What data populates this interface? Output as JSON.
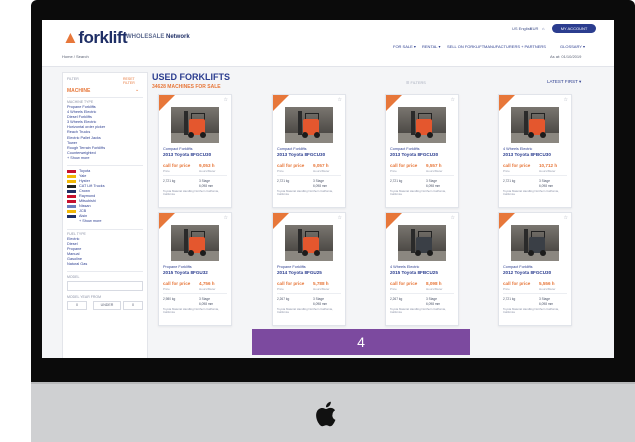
{
  "header": {
    "logo_main": "forklift",
    "logo_network_prefix": "WHOLESALE",
    "logo_network": "Network",
    "utility": [
      "US English",
      "EUR",
      "⌂"
    ],
    "account_button": "MY ACCOUNT",
    "nav": [
      "FOR SALE ▾",
      "RENTAL ▾",
      "SELL ON FORKLIFT",
      "MANUFACTURERS + PARTNERS",
      "GLOSSARY ▾"
    ],
    "breadcrumb": "Home / Search",
    "as_at": "As at: 01/10/2019"
  },
  "sidebar": {
    "filter_label": "FILTER",
    "reset_label": "RESET FILTER",
    "machine_label": "MACHINE",
    "types_heading": "MACHINE TYPE",
    "types": [
      "Propane Forklifts",
      "4 Wheels Electric",
      "Diesel Forklifts",
      "3 Wheels Electric",
      "Horizontal order picker",
      "Reach Trucks",
      "Electric Pallet Jacks",
      "Tower",
      "Rough Terrain Forklifts",
      "Counterweighted",
      "+ Show more"
    ],
    "brands": [
      {
        "label": "Toyota",
        "color": "#c8102e"
      },
      {
        "label": "Yale",
        "color": "#f2b705"
      },
      {
        "label": "Hyster",
        "color": "#f2b705"
      },
      {
        "label": "CAT Lift Trucks",
        "color": "#222222"
      },
      {
        "label": "Crown",
        "color": "#1f2f66"
      },
      {
        "label": "Raymond",
        "color": "#c8102e"
      },
      {
        "label": "Mitsubishi",
        "color": "#c8102e"
      },
      {
        "label": "Nissan",
        "color": "#6b7fbf"
      },
      {
        "label": "JCB",
        "color": "#f2b705"
      },
      {
        "label": "Aisin",
        "color": "#1f2f66"
      },
      {
        "label": "+ Show more",
        "color": "#ffffff"
      }
    ],
    "fuel_heading": "FUEL TYPE",
    "fuel": [
      "Electric",
      "Diesel",
      "Propane",
      "Manual",
      "Gasoline",
      "Natural Gas"
    ],
    "model_label": "MODEL",
    "year_label": "MODEL YEAR FROM",
    "year_from": "0",
    "year_to": "UNDER",
    "year_extra": "0"
  },
  "main": {
    "title": "USED FORKLIFTS",
    "count": "34628 MACHINES FOR SALE",
    "filters_label": "☰ FILTERS",
    "sort": "LATEST FIRST ▾"
  },
  "cards": [
    {
      "type": "Compact Forklifts",
      "name": "2013 Toyota 8FGCU30",
      "price": "call for price",
      "hours": "9,053 h",
      "sub_price": "Price",
      "sub_hours": "Hours/Meter",
      "capacity": "2,721 kg",
      "stage": "3 Stage",
      "lift": "6,098 mm",
      "dealer": "Toyota Material Handling Northern California, California",
      "body_color": "#e4572e"
    },
    {
      "type": "Compact Forklifts",
      "name": "2013 Toyota 8FGCU30",
      "price": "call for price",
      "hours": "9,057 h",
      "sub_price": "Price",
      "sub_hours": "Hours/Meter",
      "capacity": "2,721 kg",
      "stage": "3 Stage",
      "lift": "6,098 mm",
      "dealer": "Toyota Material Handling Northern California, California",
      "body_color": "#e4572e"
    },
    {
      "type": "Compact Forklifts",
      "name": "2013 Toyota 8FGCU30",
      "price": "call for price",
      "hours": "9,557 h",
      "sub_price": "Price",
      "sub_hours": "Hours/Meter",
      "capacity": "2,721 kg",
      "stage": "3 Stage",
      "lift": "6,098 mm",
      "dealer": "Toyota Material Handling Northern California, California",
      "body_color": "#e4572e"
    },
    {
      "type": "4 Wheels Electric",
      "name": "2013 Toyota 8FBCU30",
      "price": "call for price",
      "hours": "10,712 h",
      "sub_price": "Price",
      "sub_hours": "Hours/Meter",
      "capacity": "2,721 kg",
      "stage": "3 Stage",
      "lift": "6,098 mm",
      "dealer": "Toyota Material Handling Northern California, California",
      "body_color": "#e4572e"
    },
    {
      "type": "Propane Forklifts",
      "name": "2015 Toyota 8FGU32",
      "price": "call for price",
      "hours": "4,756 h",
      "sub_price": "Price",
      "sub_hours": "Hours/Meter",
      "capacity": "2,980 kg",
      "stage": "3 Stage",
      "lift": "6,098 mm",
      "dealer": "Toyota Material Handling Northern California, California",
      "body_color": "#e4572e"
    },
    {
      "type": "Propane Forklifts",
      "name": "2014 Toyota 8FGU25",
      "price": "call for price",
      "hours": "5,788 h",
      "sub_price": "Price",
      "sub_hours": "Hours/Meter",
      "capacity": "2,267 kg",
      "stage": "3 Stage",
      "lift": "6,098 mm",
      "dealer": "Toyota Material Handling Northern California, California",
      "body_color": "#e4572e"
    },
    {
      "type": "4 Wheels Electric",
      "name": "2015 Toyota 8FBCU25",
      "price": "call for price",
      "hours": "8,098 h",
      "sub_price": "Price",
      "sub_hours": "Hours/Meter",
      "capacity": "2,267 kg",
      "stage": "3 Stage",
      "lift": "6,098 mm",
      "dealer": "Toyota Material Handling Northern California, California",
      "body_color": "#3a3f46"
    },
    {
      "type": "Compact Forklifts",
      "name": "2012 Toyota 8FGCU30",
      "price": "call for price",
      "hours": "5,556 h",
      "sub_price": "Price",
      "sub_hours": "Hours/Meter",
      "capacity": "2,721 kg",
      "stage": "3 Stage",
      "lift": "6,098 mm",
      "dealer": "Toyota Material Handling Northern California, California",
      "body_color": "#3a3f46"
    }
  ],
  "pagination": {
    "current_page": "4"
  }
}
